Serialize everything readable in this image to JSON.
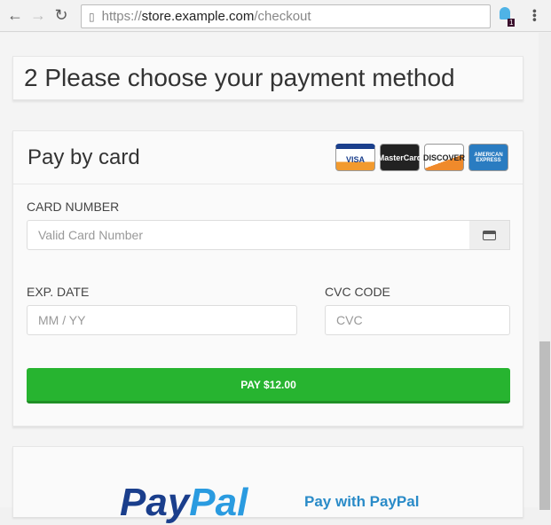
{
  "browser": {
    "url_scheme": "https://",
    "url_host": "store.example.com",
    "url_path": "/checkout",
    "extension_badge": "1"
  },
  "step": {
    "title": "2 Please choose your payment method"
  },
  "card": {
    "title": "Pay by card",
    "logos": [
      "VISA",
      "MasterCard",
      "DISCOVER",
      "AMERICAN EXPRESS"
    ],
    "card_number_label": "CARD NUMBER",
    "card_number_placeholder": "Valid Card Number",
    "exp_label": "EXP. DATE",
    "exp_placeholder": "MM / YY",
    "cvc_label": "CVC CODE",
    "cvc_placeholder": "CVC",
    "pay_button": "PAY $12.00"
  },
  "paypal": {
    "logo_text": "PayPal",
    "label": "Pay with PayPal"
  }
}
